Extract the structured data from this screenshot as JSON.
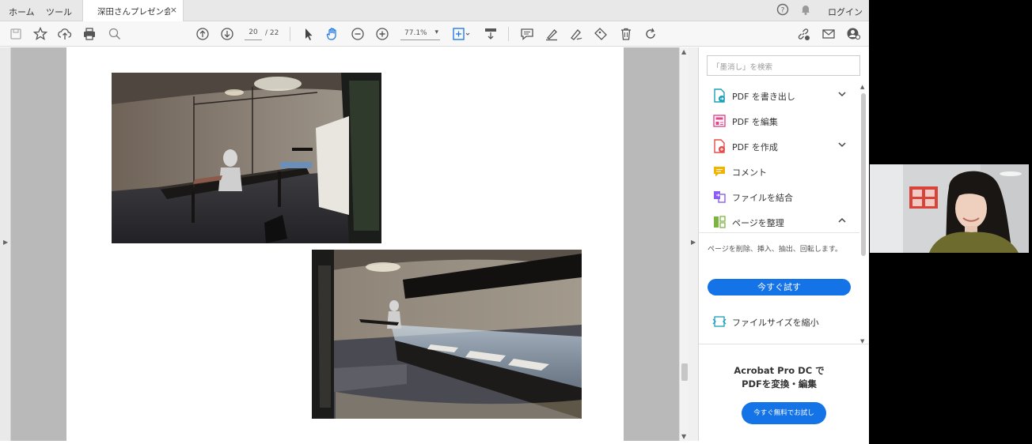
{
  "tabbar": {
    "home": "ホーム",
    "tools": "ツール",
    "doc_tab_title": "深田さんプレゼン会11...",
    "close": "×",
    "login": "ログイン"
  },
  "toolbar": {
    "page_current": "20",
    "page_total": "/ 22",
    "zoom": "77.1%",
    "zoom_caret": "▾"
  },
  "side_panel": {
    "search_placeholder": "「墨消し」を検索",
    "tools": [
      {
        "label": "PDF を書き出し",
        "icon": "export-pdf-icon",
        "color": "#1aa0b8"
      },
      {
        "label": "PDF を編集",
        "icon": "edit-pdf-icon",
        "color": "#e6458e"
      },
      {
        "label": "PDF を作成",
        "icon": "create-pdf-icon",
        "color": "#e54b4b"
      },
      {
        "label": "コメント",
        "icon": "comment-icon",
        "color": "#f0b400"
      },
      {
        "label": "ファイルを結合",
        "icon": "combine-files-icon",
        "color": "#8b5cf6"
      },
      {
        "label": "ページを整理",
        "icon": "organize-pages-icon",
        "color": "#7cb342"
      }
    ],
    "organize_desc": "ページを削除、挿入、抽出、回転します。",
    "try_now": "今すぐ試す",
    "compress_label": "ファイルサイズを縮小",
    "promo_line1": "Acrobat Pro DC で",
    "promo_line2": "PDFを変換・編集",
    "promo_button": "今すぐ無料でお試し"
  },
  "colors": {
    "accent": "#1473e6"
  }
}
